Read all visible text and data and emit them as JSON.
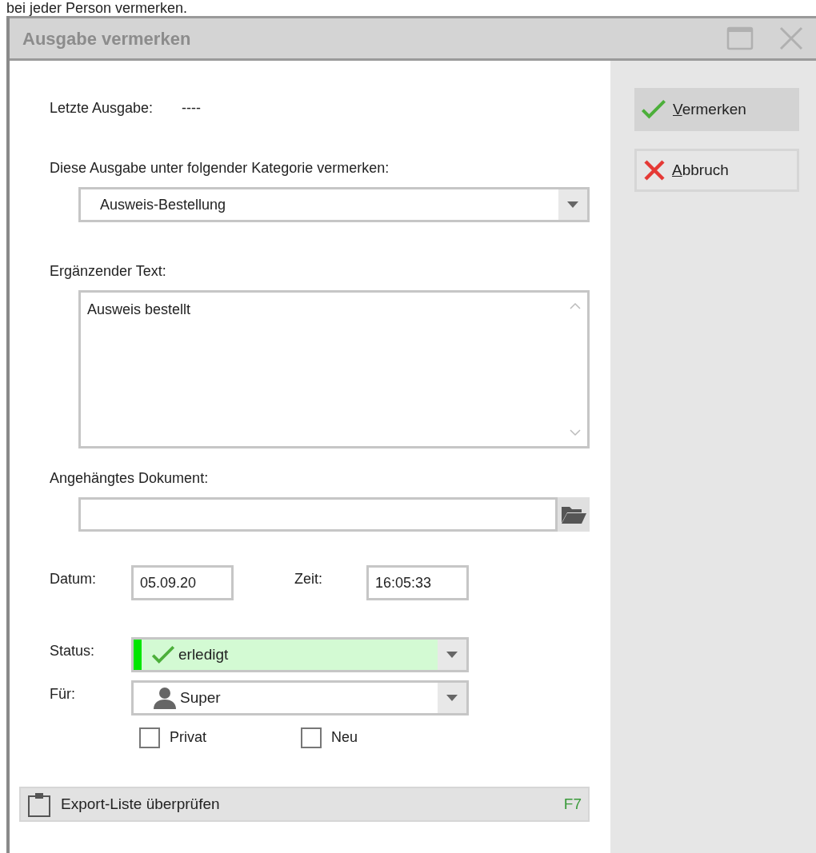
{
  "context_text": "bei jeder Person vermerken.",
  "window": {
    "title": "Ausgabe vermerken"
  },
  "last_issue": {
    "label": "Letzte Ausgabe:",
    "value": "----"
  },
  "category": {
    "label": "Diese Ausgabe unter folgender Kategorie vermerken:",
    "value": "Ausweis-Bestellung"
  },
  "supplementary_text": {
    "label": "Ergänzender Text:",
    "value": "Ausweis bestellt"
  },
  "attached_document": {
    "label": "Angehängtes Dokument:"
  },
  "date": {
    "label": "Datum:",
    "value": "05.09.20"
  },
  "time": {
    "label": "Zeit:",
    "value": "16:05:33"
  },
  "status": {
    "label": "Status:",
    "value": "erledigt"
  },
  "assignee": {
    "label": "Für:",
    "value": "Super"
  },
  "checkboxes": [
    {
      "label": "Privat",
      "checked": false
    },
    {
      "label": "Neu",
      "checked": false
    }
  ],
  "export_button": {
    "label": "Export-Liste überprüfen",
    "shortcut": "F7"
  },
  "actions": [
    {
      "kind": "confirm",
      "label": "Vermerken",
      "default": true
    },
    {
      "kind": "cancel",
      "label": "Abbruch",
      "default": false
    }
  ]
}
